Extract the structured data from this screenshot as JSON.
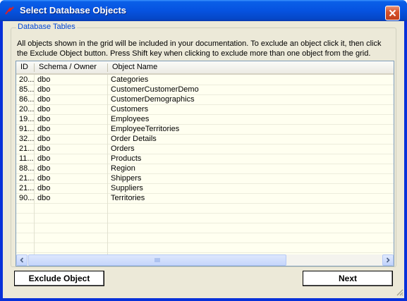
{
  "window": {
    "title": "Select Database Objects"
  },
  "group": {
    "legend": "Database Tables",
    "info_line1": "All objects shown in the grid will be included in your documentation. To exclude an object click it, then click",
    "info_line2": "the Exclude Object button. Press Shift key when clicking to exclude more than one object from the grid."
  },
  "grid": {
    "columns": [
      "ID",
      "Schema / Owner",
      "Object Name"
    ],
    "rows": [
      {
        "id": "20...",
        "schema": "dbo",
        "name": "Categories"
      },
      {
        "id": "85...",
        "schema": "dbo",
        "name": "CustomerCustomerDemo"
      },
      {
        "id": "86...",
        "schema": "dbo",
        "name": "CustomerDemographics"
      },
      {
        "id": "20...",
        "schema": "dbo",
        "name": "Customers"
      },
      {
        "id": "19...",
        "schema": "dbo",
        "name": "Employees"
      },
      {
        "id": "91...",
        "schema": "dbo",
        "name": "EmployeeTerritories"
      },
      {
        "id": "32...",
        "schema": "dbo",
        "name": "Order Details"
      },
      {
        "id": "21...",
        "schema": "dbo",
        "name": "Orders"
      },
      {
        "id": "11...",
        "schema": "dbo",
        "name": "Products"
      },
      {
        "id": "88...",
        "schema": "dbo",
        "name": "Region"
      },
      {
        "id": "21...",
        "schema": "dbo",
        "name": "Shippers"
      },
      {
        "id": "21...",
        "schema": "dbo",
        "name": "Suppliers"
      },
      {
        "id": "90...",
        "schema": "dbo",
        "name": "Territories"
      }
    ]
  },
  "buttons": {
    "exclude": "Exclude Object",
    "next": "Next"
  },
  "icons": {
    "title": "app-logo-icon",
    "close": "close-icon",
    "scroll_left": "arrow-left-icon",
    "scroll_right": "arrow-right-icon",
    "grip": "resize-grip-icon"
  },
  "colors": {
    "titlebar": "#0653e0",
    "close": "#d8532c",
    "grid_bg": "#fffff0",
    "legend": "#0046d5",
    "face": "#ece9d8"
  }
}
